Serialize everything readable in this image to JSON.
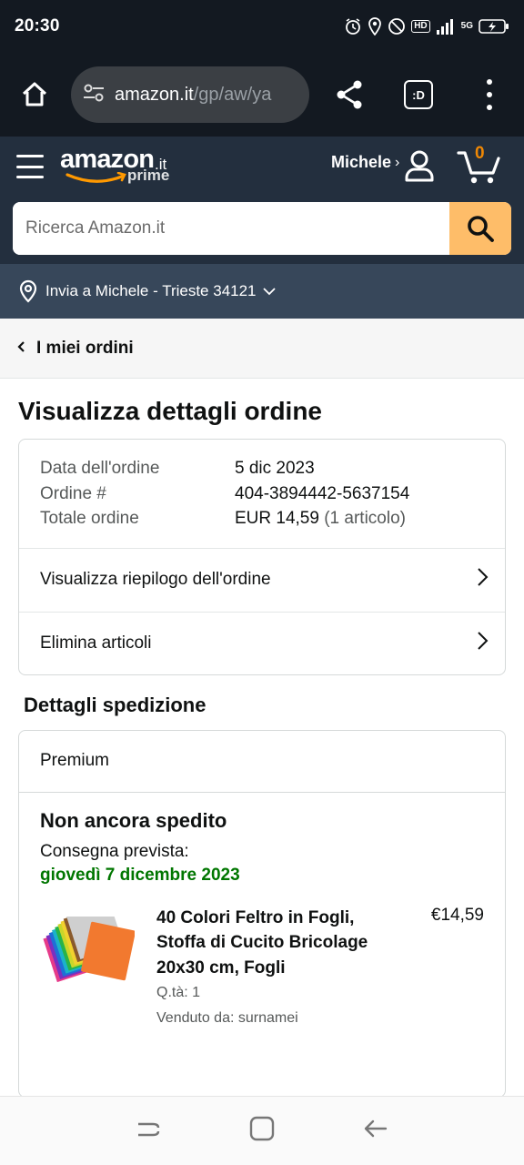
{
  "status_bar": {
    "time": "20:30",
    "hd": "HD",
    "network": "5G"
  },
  "browser": {
    "url_host": "amazon.it",
    "url_path": "/gp/aw/ya",
    "tabs_label": ":D"
  },
  "header": {
    "logo_text": "amazon",
    "logo_tld": ".it",
    "logo_prime": "prime",
    "account_name": "Michele",
    "account_chevron": "›",
    "cart_count": "0"
  },
  "search": {
    "placeholder": "Ricerca Amazon.it"
  },
  "deliver": {
    "text": "Invia a Michele - Trieste 34121"
  },
  "back": {
    "label": "I miei ordini"
  },
  "page": {
    "title": "Visualizza dettagli ordine"
  },
  "order": {
    "rows": [
      {
        "label": "Data dell'ordine",
        "value": "5 dic 2023"
      },
      {
        "label": "Ordine #",
        "value": "404-3894442-5637154"
      },
      {
        "label": "Totale ordine",
        "value": "EUR 14,59",
        "extra": "(1 articolo)"
      }
    ],
    "links": [
      {
        "label": "Visualizza riepilogo dell'ordine"
      },
      {
        "label": "Elimina articoli"
      }
    ]
  },
  "shipping": {
    "section_title": "Dettagli spedizione",
    "method": "Premium",
    "status": "Non ancora spedito",
    "eta_label": "Consegna prevista:",
    "eta_date": "giovedì 7 dicembre 2023",
    "item": {
      "title": "40 Colori Feltro in Fogli, Stoffa di Cucito Bricolage 20x30 cm, Fogli",
      "price": "€14,59",
      "qty": "Q.tà: 1",
      "seller": "Venduto da: surnamei"
    }
  },
  "colors": {
    "header_dark": "#131921",
    "header_nav": "#232f3e",
    "deliver_bar": "#37475a",
    "search_button": "#febd69",
    "cart_count": "#f08804",
    "eta_green": "#007600"
  },
  "icons": {
    "home": "home-icon",
    "tune": "tune-icon",
    "share": "share-icon",
    "menu": "more-vert-icon",
    "hamburger": "hamburger-icon",
    "user": "user-icon",
    "cart": "cart-icon",
    "search": "search-icon",
    "location": "location-pin-icon",
    "chevron": "chevron-right-icon"
  }
}
